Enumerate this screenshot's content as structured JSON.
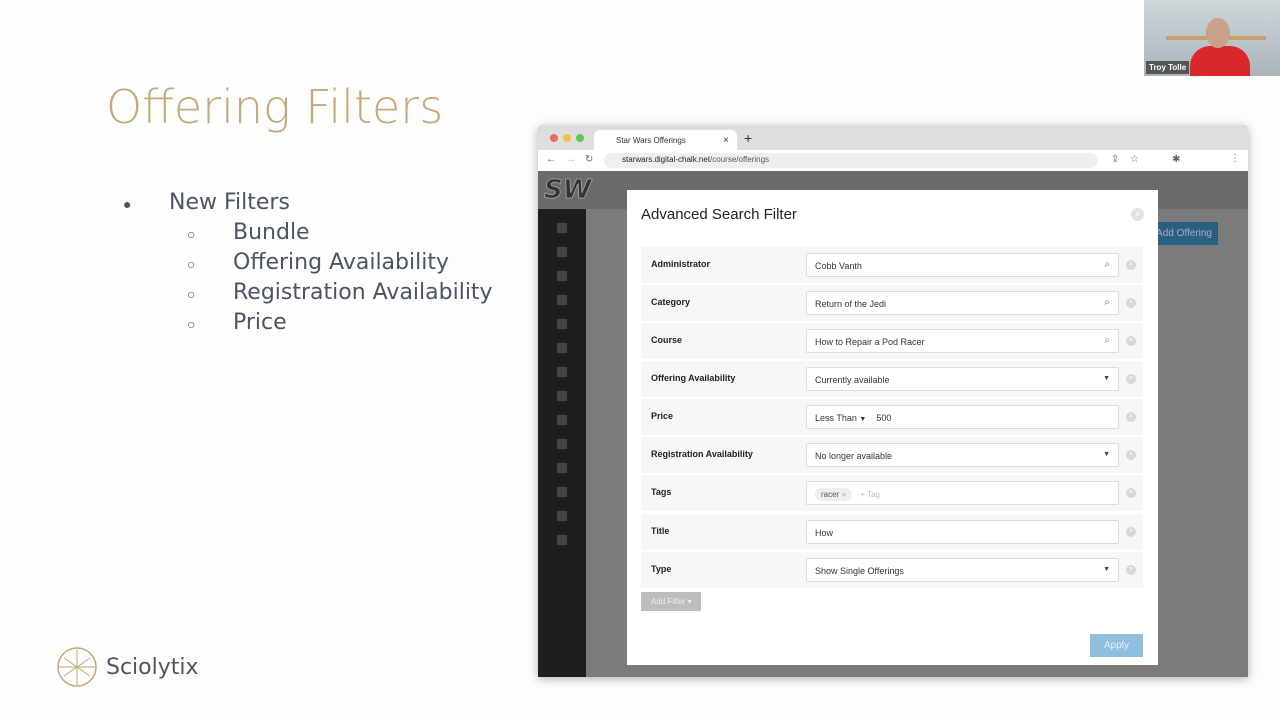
{
  "slide": {
    "title": "Offering Filters",
    "bullet": "New Filters",
    "sub": [
      "Bundle",
      "Offering Availability",
      "Registration Availability",
      "Price"
    ]
  },
  "brand": {
    "name": "Sciolytix",
    "color": "#c4a97a"
  },
  "video": {
    "name": "Troy Tolle"
  },
  "browser": {
    "tab": "Star Wars Offerings",
    "url_host": "starwars.digital-chalk.net",
    "url_path": "/course/offerings"
  },
  "app": {
    "logo": "SW",
    "add_offering": "Add Offering"
  },
  "modal": {
    "title": "Advanced Search Filter",
    "filters": [
      {
        "label": "Administrator",
        "value": "Cobb Vanth",
        "kind": "search"
      },
      {
        "label": "Category",
        "value": "Return of the Jedi",
        "kind": "search"
      },
      {
        "label": "Course",
        "value": "How to Repair a Pod Racer",
        "kind": "search"
      },
      {
        "label": "Offering Availability",
        "value": "Currently available",
        "kind": "select"
      },
      {
        "label": "Price",
        "operator": "Less Than",
        "value": "500",
        "kind": "price"
      },
      {
        "label": "Registration Availability",
        "value": "No longer available",
        "kind": "select"
      },
      {
        "label": "Tags",
        "tag": "racer",
        "placeholder": "+ Tag",
        "kind": "tags"
      },
      {
        "label": "Title",
        "value": "How",
        "kind": "text"
      },
      {
        "label": "Type",
        "value": "Show Single Offerings",
        "kind": "select"
      }
    ],
    "add_filter": "Add Filter ▾",
    "apply": "Apply"
  }
}
